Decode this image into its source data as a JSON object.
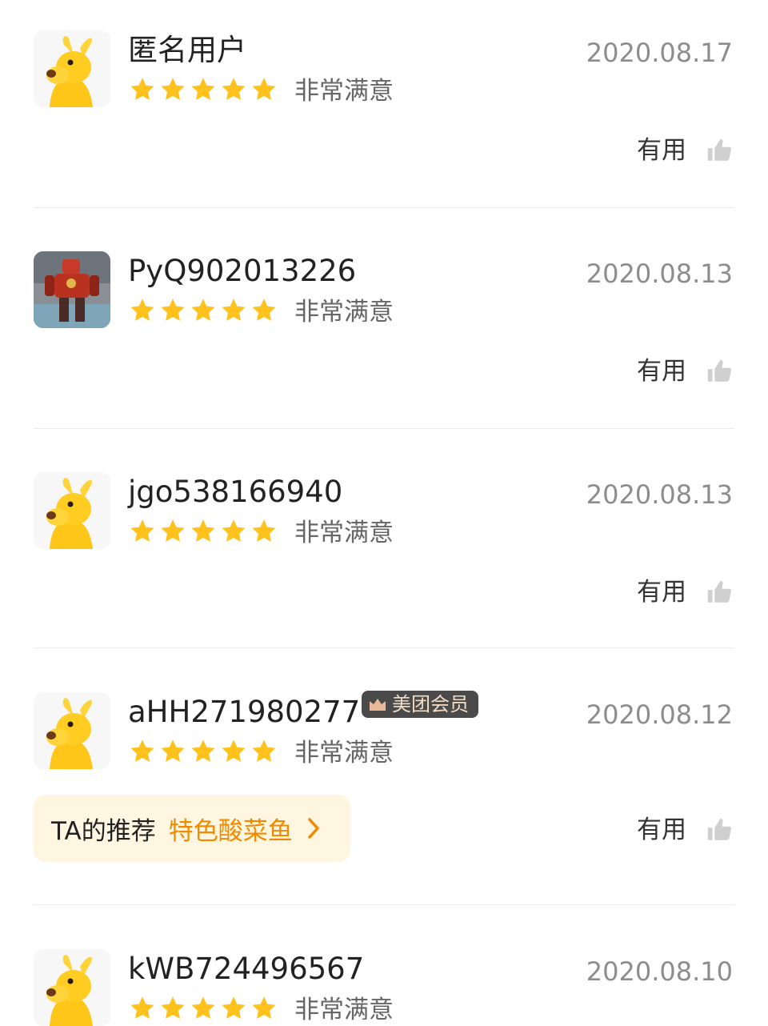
{
  "colors": {
    "star": "#ffc21c",
    "accent": "#f08a00",
    "badge_bg": "#4a4a4a",
    "divider": "#ececec"
  },
  "reviews": [
    {
      "username": "匿名用户",
      "date": "2020.08.17",
      "rating": 5,
      "rating_text": "非常满意",
      "helpful_label": "有用",
      "avatar": "kangaroo-avatar"
    },
    {
      "username": "PyQ902013226",
      "date": "2020.08.13",
      "rating": 5,
      "rating_text": "非常满意",
      "helpful_label": "有用",
      "avatar": "robot-photo-avatar"
    },
    {
      "username": "jgo538166940",
      "date": "2020.08.13",
      "rating": 5,
      "rating_text": "非常满意",
      "helpful_label": "有用",
      "avatar": "kangaroo-avatar"
    },
    {
      "username": "aHH271980277",
      "badge": "美团会员",
      "date": "2020.08.12",
      "rating": 5,
      "rating_text": "非常满意",
      "helpful_label": "有用",
      "avatar": "kangaroo-avatar",
      "recommendation": {
        "label": "TA的推荐",
        "dish": "特色酸菜鱼"
      }
    },
    {
      "username": "kWB724496567",
      "date": "2020.08.10",
      "rating": 5,
      "rating_text": "非常满意",
      "avatar": "kangaroo-avatar"
    }
  ]
}
